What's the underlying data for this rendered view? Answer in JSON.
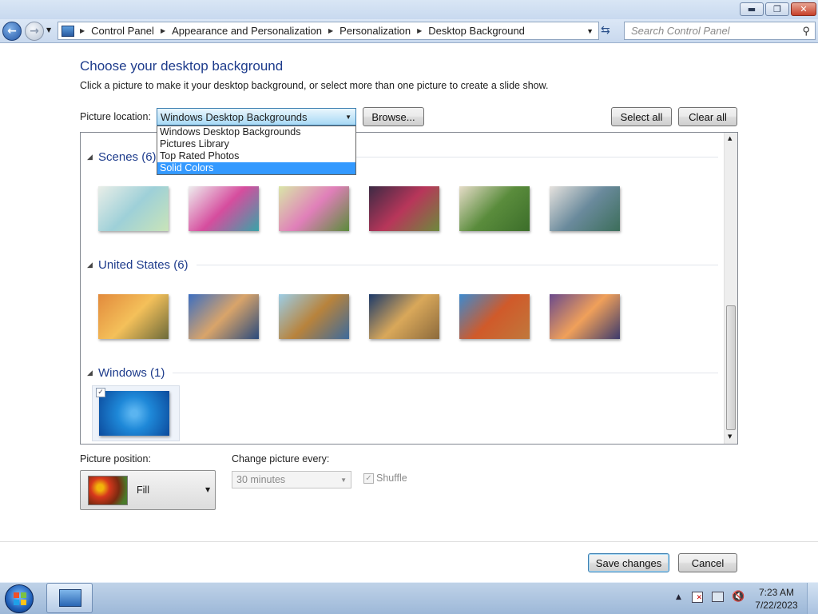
{
  "window": {
    "caption_buttons": {
      "minimize": "▬",
      "maximize": "❐",
      "close": "✕"
    }
  },
  "address_bar": {
    "breadcrumbs": [
      "Control Panel",
      "Appearance and Personalization",
      "Personalization",
      "Desktop Background"
    ],
    "search_placeholder": "Search Control Panel"
  },
  "page": {
    "title": "Choose your desktop background",
    "subtitle": "Click a picture to make it your desktop background, or select more than one picture to create a slide show.",
    "picture_location_label": "Picture location:",
    "picture_location_value": "Windows Desktop Backgrounds",
    "browse_label": "Browse...",
    "select_all_label": "Select all",
    "clear_all_label": "Clear all",
    "location_options": [
      "Windows Desktop Backgrounds",
      "Pictures Library",
      "Top Rated Photos",
      "Solid Colors"
    ],
    "highlighted_option": "Solid Colors"
  },
  "gallery": {
    "groups": [
      {
        "title": "Scenes (6)",
        "thumbs": 6,
        "colors": [
          [
            "#e9eee8",
            "#9ed0d8",
            "#c9e4b8"
          ],
          [
            "#eeeeee",
            "#d64d9e",
            "#38a4a8"
          ],
          [
            "#d9e6a8",
            "#e07fb9",
            "#5a8c3a"
          ],
          [
            "#3c2a44",
            "#b8365a",
            "#6c8a3c"
          ],
          [
            "#e6dcc8",
            "#5a8c3c",
            "#3c6e2a"
          ],
          [
            "#e6e2de",
            "#6a8a9c",
            "#3c6e5a"
          ]
        ]
      },
      {
        "title": "United States (6)",
        "thumbs": 6,
        "colors": [
          [
            "#e28a3c",
            "#f4c05a",
            "#6c6a3a"
          ],
          [
            "#3c6ec0",
            "#d9a46a",
            "#2a4a7c"
          ],
          [
            "#9ccde6",
            "#b8833c",
            "#3c6a9c"
          ],
          [
            "#1c3a6a",
            "#d9a85a",
            "#8c6a3c"
          ],
          [
            "#3c8ad0",
            "#d05a2a",
            "#c0783c"
          ],
          [
            "#6a4a8c",
            "#f0a05a",
            "#3c3a6c"
          ]
        ]
      },
      {
        "title": "Windows (1)",
        "thumbs": 1,
        "colors": [
          [
            "#1e88d8",
            "#0c4a9c",
            "#5ab4f0"
          ]
        ]
      }
    ]
  },
  "picture_position": {
    "label": "Picture position:",
    "value": "Fill"
  },
  "change_picture": {
    "label": "Change picture every:",
    "value": "30 minutes"
  },
  "shuffle": {
    "label": "Shuffle",
    "checked": true,
    "disabled": true
  },
  "footer": {
    "save_label": "Save changes",
    "cancel_label": "Cancel"
  },
  "taskbar": {
    "time": "7:23 AM",
    "date": "7/22/2023"
  }
}
